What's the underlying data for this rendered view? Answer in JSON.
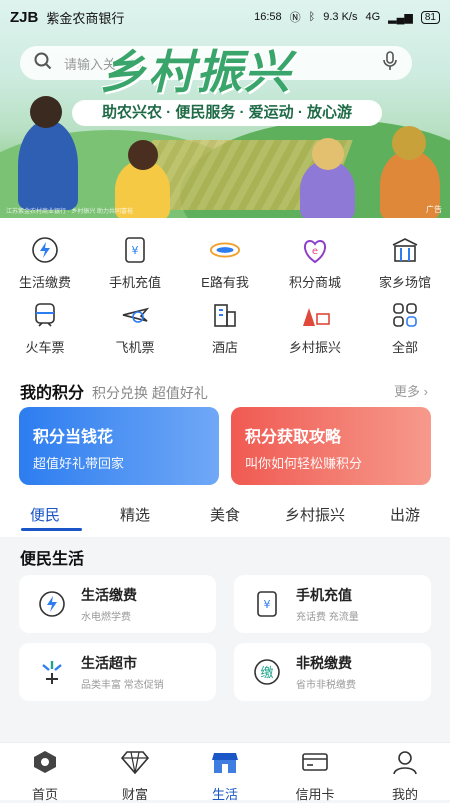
{
  "status": {
    "carrier": "ZJB",
    "time": "16:58",
    "bank": "紫金农商银行",
    "network": "4G",
    "speed": "9.3 K/s",
    "battery": "81"
  },
  "search": {
    "placeholder": "请输入关键词"
  },
  "banner": {
    "title": "乡村振兴",
    "subtitle": "助农兴农 · 便民服务 · 爱运动 · 放心游",
    "note": "江苏紫金农村商业银行 · 乡村振兴 助力共同富裕",
    "ad": "广告"
  },
  "services": [
    {
      "label": "生活缴费",
      "icon": "bolt-icon"
    },
    {
      "label": "手机充值",
      "icon": "phone-yen-icon"
    },
    {
      "label": "E路有我",
      "icon": "e-road-icon"
    },
    {
      "label": "积分商城",
      "icon": "points-mall-icon"
    },
    {
      "label": "家乡场馆",
      "icon": "venue-icon"
    },
    {
      "label": "火车票",
      "icon": "train-icon"
    },
    {
      "label": "飞机票",
      "icon": "plane-icon"
    },
    {
      "label": "酒店",
      "icon": "hotel-icon"
    },
    {
      "label": "乡村振兴",
      "icon": "rural-icon"
    },
    {
      "label": "全部",
      "icon": "grid-icon"
    }
  ],
  "points": {
    "title": "我的积分",
    "subtitle": "积分兑换 超值好礼",
    "more": "更多",
    "cards": [
      {
        "title": "积分当钱花",
        "sub": "超值好礼带回家"
      },
      {
        "title": "积分获取攻略",
        "sub": "叫你如何轻松赚积分"
      }
    ]
  },
  "tabs": [
    "便民",
    "精选",
    "美食",
    "乡村振兴",
    "出游"
  ],
  "life": {
    "title": "便民生活",
    "items": [
      {
        "name": "生活缴费",
        "desc": "水电燃学费"
      },
      {
        "name": "手机充值",
        "desc": "充话费 充流量"
      },
      {
        "name": "生活超市",
        "desc": "品类丰富 常态促销"
      },
      {
        "name": "非税缴费",
        "desc": "省市非税缴费"
      }
    ]
  },
  "nav": [
    "首页",
    "财富",
    "生活",
    "信用卡",
    "我的"
  ],
  "colors": {
    "accent": "#1a56c6",
    "red": "#f05a52",
    "blue": "#2d7df0"
  }
}
